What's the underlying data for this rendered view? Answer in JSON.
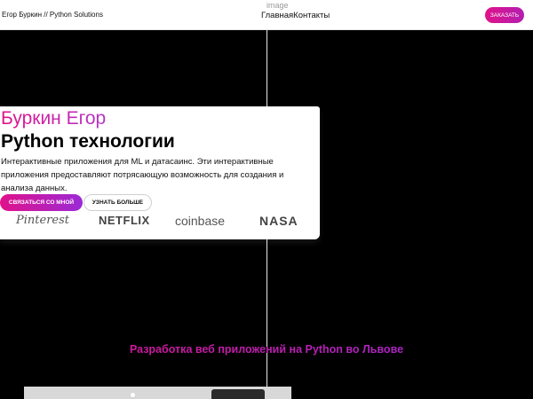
{
  "header": {
    "brand": "Егор Буркин // Python Solutions",
    "nav": {
      "home": "Главная",
      "contacts": "Контакты"
    },
    "order_label": "ЗАКАЗАТЬ"
  },
  "image_label": "image",
  "hero": {
    "name": "Буркин Егор",
    "title": "Python технологии",
    "description": "Интерактивные приложения для ML и датасаинс. Эти интерактивные приложения предоставляют потрясающую возможность для создания и анализа данных.",
    "contact_label": "СВЯЗАТЬСЯ СО МНОЙ",
    "more_label": "УЗНАТЬ БОЛЬШЕ",
    "logos": [
      "Pinterest",
      "NETFLIX",
      "coinbase",
      "NASA"
    ]
  },
  "section": {
    "heading": "Разработка веб приложений на Python во Львове"
  },
  "colors": {
    "accent_start": "#e0128a",
    "accent_end": "#9b2ad6",
    "background": "#000000"
  }
}
